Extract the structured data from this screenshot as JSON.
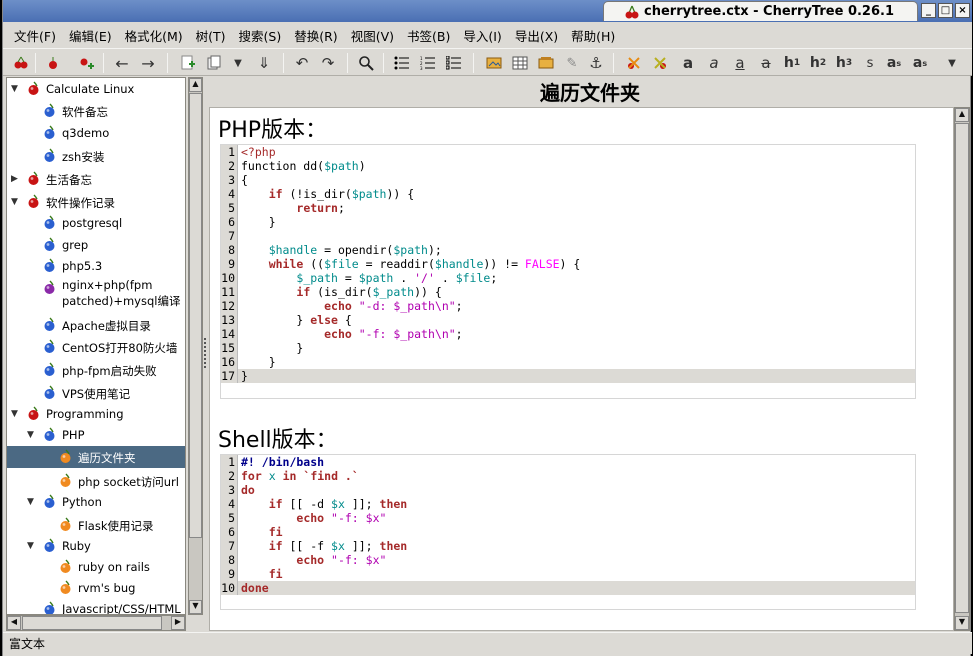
{
  "window": {
    "title": "cherrytree.ctx - CherryTree 0.26.1"
  },
  "menu": [
    "文件(F)",
    "编辑(E)",
    "格式化(M)",
    "树(T)",
    "搜索(S)",
    "替换(R)",
    "视图(V)",
    "书签(B)",
    "导入(I)",
    "导出(X)",
    "帮助(H)"
  ],
  "tree": [
    {
      "label": "Calculate Linux",
      "depth": 0,
      "icon": "cherry-red-icon",
      "expander": "▼"
    },
    {
      "label": "软件备忘",
      "depth": 1,
      "icon": "cherry-blue-icon",
      "expander": ""
    },
    {
      "label": "q3demo",
      "depth": 1,
      "icon": "cherry-blue-icon",
      "expander": ""
    },
    {
      "label": "zsh安装",
      "depth": 1,
      "icon": "cherry-blue-icon",
      "expander": ""
    },
    {
      "label": "生活备忘",
      "depth": 0,
      "icon": "cherry-red-icon",
      "expander": "▶"
    },
    {
      "label": "软件操作记录",
      "depth": 0,
      "icon": "cherry-red-icon",
      "expander": "▼"
    },
    {
      "label": "postgresql",
      "depth": 1,
      "icon": "cherry-blue-icon",
      "expander": ""
    },
    {
      "label": "grep",
      "depth": 1,
      "icon": "cherry-blue-icon",
      "expander": ""
    },
    {
      "label": "php5.3",
      "depth": 1,
      "icon": "cherry-blue-icon",
      "expander": ""
    },
    {
      "label": "nginx+php(fpm",
      "label2": "patched)+mysql编译",
      "depth": 1,
      "icon": "cherry-purple-icon",
      "expander": ""
    },
    {
      "label": "Apache虚拟目录",
      "depth": 1,
      "icon": "cherry-blue-icon",
      "expander": ""
    },
    {
      "label": "CentOS打开80防火墙",
      "depth": 1,
      "icon": "cherry-blue-icon",
      "expander": ""
    },
    {
      "label": "php-fpm启动失败",
      "depth": 1,
      "icon": "cherry-blue-icon",
      "expander": ""
    },
    {
      "label": "VPS使用笔记",
      "depth": 1,
      "icon": "cherry-blue-icon",
      "expander": ""
    },
    {
      "label": "Programming",
      "depth": 0,
      "icon": "cherry-red-icon",
      "expander": "▼"
    },
    {
      "label": "PHP",
      "depth": 1,
      "icon": "cherry-blue-icon",
      "expander": "▼"
    },
    {
      "label": "遍历文件夹",
      "depth": 2,
      "icon": "cherry-orange-icon",
      "expander": "",
      "selected": true
    },
    {
      "label": "php socket访问url",
      "depth": 2,
      "icon": "cherry-orange-icon",
      "expander": ""
    },
    {
      "label": "Python",
      "depth": 1,
      "icon": "cherry-blue-icon",
      "expander": "▼"
    },
    {
      "label": "Flask使用记录",
      "depth": 2,
      "icon": "cherry-orange-icon",
      "expander": ""
    },
    {
      "label": "Ruby",
      "depth": 1,
      "icon": "cherry-blue-icon",
      "expander": "▼"
    },
    {
      "label": "ruby on rails",
      "depth": 2,
      "icon": "cherry-orange-icon",
      "expander": ""
    },
    {
      "label": "rvm's bug",
      "depth": 2,
      "icon": "cherry-orange-icon",
      "expander": ""
    },
    {
      "label": "Javascript/CSS/HTML",
      "depth": 1,
      "icon": "cherry-blue-icon",
      "expander": ""
    }
  ],
  "node": {
    "title": "遍历文件夹",
    "php_heading": "PHP版本：",
    "shell_heading": "Shell版本：",
    "php_code": [
      [
        [
          "php",
          "<?php"
        ]
      ],
      [
        [
          "",
          "function dd("
        ],
        [
          "var",
          "$path"
        ],
        [
          "",
          ")"
        ]
      ],
      [
        [
          "",
          "{"
        ]
      ],
      [
        [
          "",
          "    "
        ],
        [
          "kw",
          "if"
        ],
        [
          "",
          " (!is_dir("
        ],
        [
          "var",
          "$path"
        ],
        [
          "",
          ")) {"
        ]
      ],
      [
        [
          "",
          "        "
        ],
        [
          "kw",
          "return"
        ],
        [
          "",
          ";"
        ]
      ],
      [
        [
          "",
          "    }"
        ]
      ],
      [
        [
          "",
          ""
        ]
      ],
      [
        [
          "",
          "    "
        ],
        [
          "var",
          "$handle"
        ],
        [
          "",
          " = opendir("
        ],
        [
          "var",
          "$path"
        ],
        [
          "",
          ");"
        ]
      ],
      [
        [
          "",
          "    "
        ],
        [
          "kw",
          "while"
        ],
        [
          "",
          " (("
        ],
        [
          "var",
          "$file"
        ],
        [
          "",
          " = readdir("
        ],
        [
          "var",
          "$handle"
        ],
        [
          "",
          ")) != "
        ],
        [
          "const",
          "FALSE"
        ],
        [
          "",
          ") {"
        ]
      ],
      [
        [
          "",
          "        "
        ],
        [
          "var",
          "$_path"
        ],
        [
          "",
          " = "
        ],
        [
          "var",
          "$path"
        ],
        [
          "",
          " . "
        ],
        [
          "str",
          "'/'"
        ],
        [
          "",
          " . "
        ],
        [
          "var",
          "$file"
        ],
        [
          "",
          ";"
        ]
      ],
      [
        [
          "",
          "        "
        ],
        [
          "kw",
          "if"
        ],
        [
          "",
          " (is_dir("
        ],
        [
          "var",
          "$_path"
        ],
        [
          "",
          ")) {"
        ]
      ],
      [
        [
          "",
          "            "
        ],
        [
          "kw",
          "echo"
        ],
        [
          "",
          " "
        ],
        [
          "str",
          "\"-d: $_path\\n\""
        ],
        [
          "",
          ";"
        ]
      ],
      [
        [
          "",
          "        } "
        ],
        [
          "kw",
          "else"
        ],
        [
          "",
          " {"
        ]
      ],
      [
        [
          "",
          "            "
        ],
        [
          "kw",
          "echo"
        ],
        [
          "",
          " "
        ],
        [
          "str",
          "\"-f: $_path\\n\""
        ],
        [
          "",
          ";"
        ]
      ],
      [
        [
          "",
          "        }"
        ]
      ],
      [
        [
          "",
          "    }"
        ]
      ],
      [
        [
          "",
          "}"
        ]
      ]
    ],
    "shell_code": [
      [
        [
          "sh",
          "#! /bin/bash"
        ]
      ],
      [
        [
          "kw",
          "for"
        ],
        [
          "",
          " "
        ],
        [
          "var",
          "x"
        ],
        [
          "",
          " "
        ],
        [
          "kw",
          "in"
        ],
        [
          "",
          " "
        ],
        [
          "kw",
          "`find .`"
        ]
      ],
      [
        [
          "kw",
          "do"
        ]
      ],
      [
        [
          "",
          "    "
        ],
        [
          "kw",
          "if"
        ],
        [
          "",
          " [[ -d "
        ],
        [
          "var",
          "$x"
        ],
        [
          "",
          " ]]; "
        ],
        [
          "kw",
          "then"
        ]
      ],
      [
        [
          "",
          "        "
        ],
        [
          "kw",
          "echo"
        ],
        [
          "",
          " "
        ],
        [
          "str",
          "\"-f: $x\""
        ]
      ],
      [
        [
          "",
          "    "
        ],
        [
          "kw",
          "fi"
        ]
      ],
      [
        [
          "",
          "    "
        ],
        [
          "kw",
          "if"
        ],
        [
          "",
          " [[ -f "
        ],
        [
          "var",
          "$x"
        ],
        [
          "",
          " ]]; "
        ],
        [
          "kw",
          "then"
        ]
      ],
      [
        [
          "",
          "        "
        ],
        [
          "kw",
          "echo"
        ],
        [
          "",
          " "
        ],
        [
          "str",
          "\"-f: $x\""
        ]
      ],
      [
        [
          "",
          "    "
        ],
        [
          "kw",
          "fi"
        ]
      ],
      [
        [
          "kw",
          "done"
        ]
      ]
    ]
  },
  "status": "富文本"
}
